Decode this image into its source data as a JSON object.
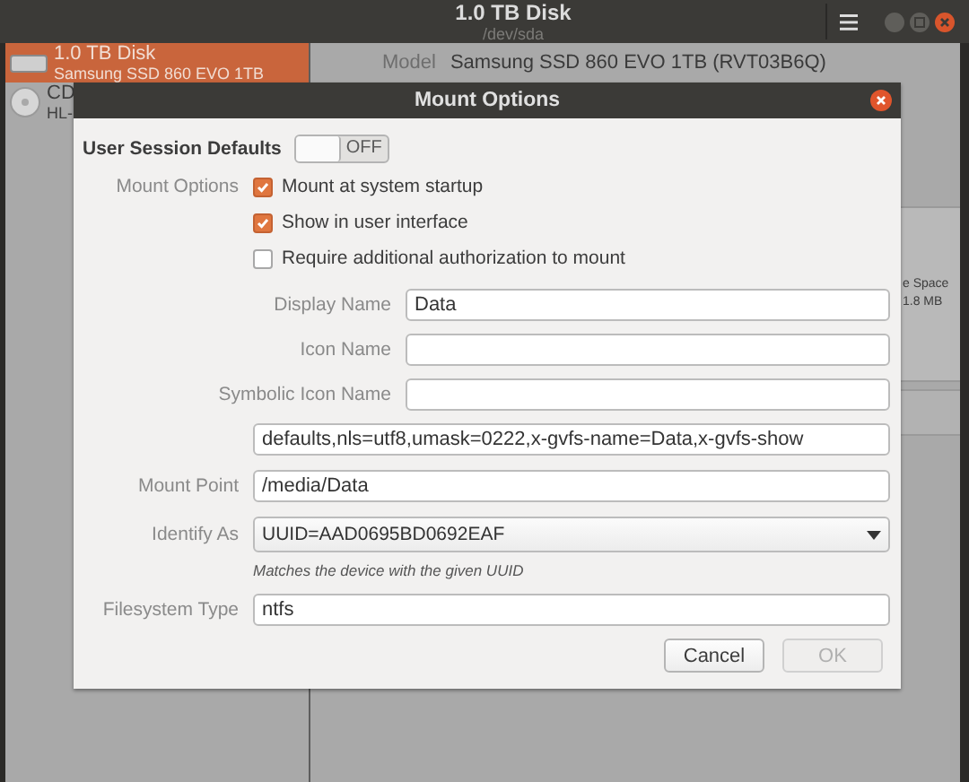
{
  "window": {
    "title": "1.0 TB Disk",
    "subtitle": "/dev/sda"
  },
  "sidebar": {
    "items": [
      {
        "title": "1.0 TB Disk",
        "subtitle": "Samsung SSD 860 EVO 1TB",
        "kind": "disk",
        "selected": true
      },
      {
        "title": "CD",
        "subtitle": "HL-",
        "kind": "optical",
        "selected": false
      }
    ]
  },
  "details": {
    "model_label": "Model",
    "model_value": "Samsung SSD 860 EVO 1TB (RVT03B6Q)",
    "partition_lines": [
      "e Space",
      "1.8 MB"
    ]
  },
  "dialog": {
    "title": "Mount Options",
    "session_defaults": {
      "label": "User Session Defaults",
      "on": false,
      "state_label": "OFF"
    },
    "mount_options_label": "Mount Options",
    "checkboxes": [
      {
        "label": "Mount at system startup",
        "checked": true
      },
      {
        "label": "Show in user interface",
        "checked": true
      },
      {
        "label": "Require additional authorization to mount",
        "checked": false
      }
    ],
    "name_fields": [
      {
        "label": "Display Name",
        "value": "Data"
      },
      {
        "label": "Icon Name"
      },
      {
        "label": "Symbolic Icon Name"
      }
    ],
    "options_field": {
      "value": "defaults,nls=utf8,umask=0222,x-gvfs-name=Data,x-gvfs-show"
    },
    "fields": [
      {
        "label": "Mount Point",
        "value": "/media/Data",
        "kind": "entry"
      },
      {
        "label": "Identify As",
        "value": "UUID=AAD0695BD0692EAF",
        "kind": "dropdown",
        "hint": "Matches the device with the given UUID"
      },
      {
        "label": "Filesystem Type",
        "value": "ntfs",
        "kind": "entry"
      }
    ],
    "buttons": [
      {
        "label": "Cancel",
        "disabled": false
      },
      {
        "label": "OK",
        "disabled": true
      }
    ]
  }
}
